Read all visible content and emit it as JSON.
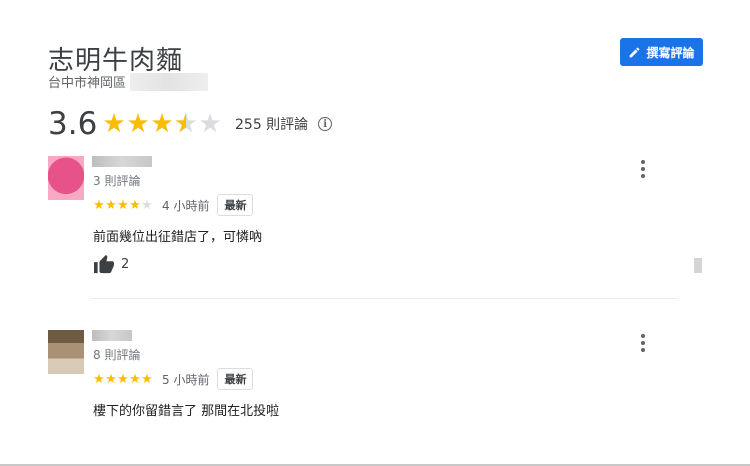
{
  "place": {
    "name": "志明牛肉麵",
    "address": "台中市神岡區"
  },
  "write_review_button": {
    "label": "撰寫評論",
    "icon": "pencil-icon"
  },
  "summary": {
    "rating": "3.6",
    "rating_value": 3.6,
    "stars_filled_fraction": 0.72,
    "review_count_text": "255 則評論",
    "info_icon": "info-icon"
  },
  "reviews": [
    {
      "reviewer_review_count": "3 則評論",
      "stars": 4,
      "time": "4 小時前",
      "badge": "最新",
      "text": "前面幾位出征錯店了，可憐吶",
      "likes": "2"
    },
    {
      "reviewer_review_count": "8 則評論",
      "stars": 5,
      "time": "5 小時前",
      "badge": "最新",
      "text": "樓下的你留錯言了 那間在北投啦"
    }
  ],
  "colors": {
    "accent": "#1a73e8",
    "star": "#fbbc04",
    "star_empty": "#dadce0"
  }
}
